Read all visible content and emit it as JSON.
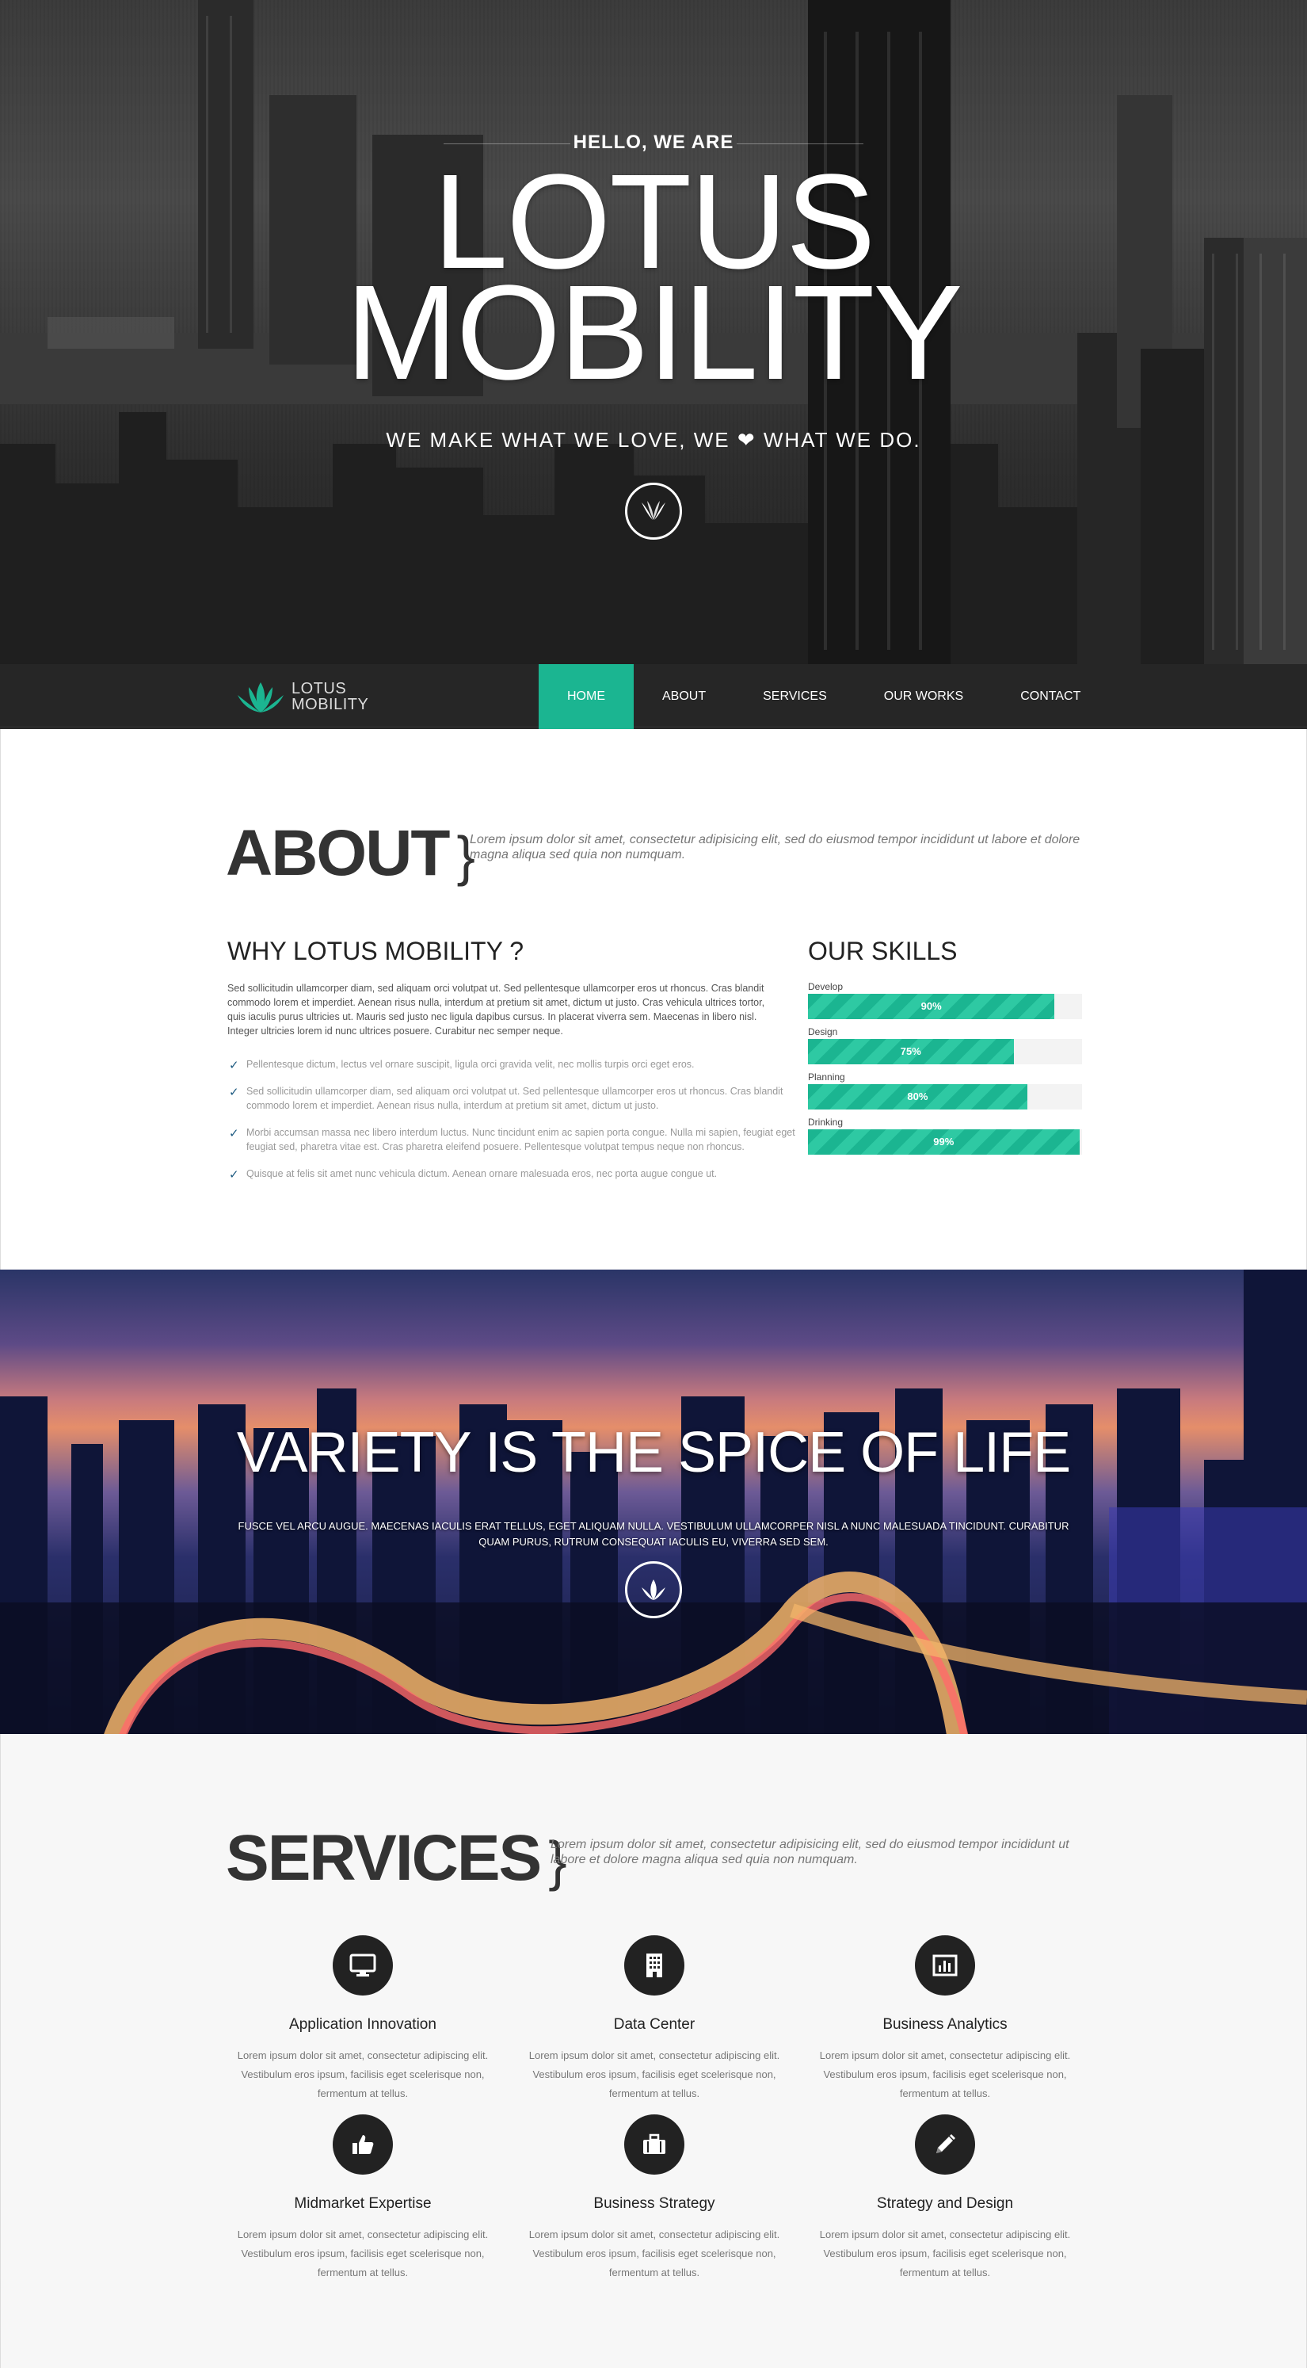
{
  "hero": {
    "greeting": "HELLO, WE ARE",
    "title_line1": "LOTUS",
    "title_line2": "MOBILITY",
    "tagline_before": "WE MAKE WHAT WE LOVE, WE",
    "tagline_after": "WHAT WE DO.",
    "heart_glyph": "❤",
    "scroll_icon": "lotus-icon"
  },
  "nav": {
    "logo_line1": "LOTUS",
    "logo_line2": "MOBILITY",
    "items": [
      {
        "label": "HOME",
        "active": true
      },
      {
        "label": "ABOUT",
        "active": false
      },
      {
        "label": "SERVICES",
        "active": false
      },
      {
        "label": "OUR WORKS",
        "active": false
      },
      {
        "label": "CONTACT",
        "active": false
      }
    ]
  },
  "about": {
    "heading": "ABOUT",
    "brace": "}",
    "intro": "Lorem ipsum dolor sit amet, consectetur adipisicing elit, sed do eiusmod tempor incididunt ut labore et dolore magna aliqua sed quia non numquam.",
    "why_title": "WHY LOTUS MOBILITY ?",
    "why_paragraph": "Sed sollicitudin ullamcorper diam, sed aliquam orci volutpat ut. Sed pellentesque ullamcorper eros ut rhoncus. Cras blandit commodo lorem et imperdiet. Aenean risus nulla, interdum at pretium sit amet, dictum ut justo. Cras vehicula ultrices tortor, quis iaculis purus ultricies ut. Mauris sed justo nec ligula dapibus cursus. In placerat viverra sem. Maecenas in libero nisl. Integer ultricies lorem id nunc ultrices posuere. Curabitur nec semper neque.",
    "checklist": [
      "Pellentesque dictum, lectus vel ornare suscipit, ligula orci gravida velit, nec mollis turpis orci eget eros.",
      "Sed sollicitudin ullamcorper diam, sed aliquam orci volutpat ut. Sed pellentesque ullamcorper eros ut rhoncus. Cras blandit commodo lorem et imperdiet. Aenean risus nulla, interdum at pretium sit amet, dictum ut justo.",
      "Morbi accumsan massa nec libero interdum luctus. Nunc tincidunt enim ac sapien porta congue. Nulla mi sapien, feugiat eget feugiat sed, pharetra vitae est. Cras pharetra eleifend posuere. Pellentesque volutpat tempus neque non rhoncus.",
      "Quisque at felis sit amet nunc vehicula dictum. Aenean ornare malesuada eros, nec porta augue congue ut."
    ],
    "skills_title": "OUR SKILLS",
    "skills": [
      {
        "label": "Develop",
        "percent_text": "90%",
        "value": 90
      },
      {
        "label": "Design",
        "percent_text": "75%",
        "value": 75
      },
      {
        "label": "Planning",
        "percent_text": "80%",
        "value": 80
      },
      {
        "label": "Drinking",
        "percent_text": "99%",
        "value": 99
      }
    ],
    "accent_color": "#1bb591"
  },
  "variety": {
    "title": "VARIETY IS THE SPICE OF LIFE",
    "text": "FUSCE VEL ARCU AUGUE. MAECENAS IACULIS ERAT TELLUS, EGET ALIQUAM NULLA. VESTIBULUM ULLAMCORPER NISL A NUNC MALESUADA TINCIDUNT. CURABITUR QUAM PURUS, RUTRUM CONSEQUAT IACULIS EU, VIVERRA SED SEM.",
    "scroll_icon": "lotus-icon"
  },
  "services": {
    "heading": "SERVICES",
    "brace": "}",
    "intro": "Lorem ipsum dolor sit amet, consectetur adipisicing elit, sed do eiusmod tempor incididunt ut labore et dolore magna aliqua sed quia non numquam.",
    "items": [
      {
        "icon": "monitor-icon",
        "title": "Application Innovation",
        "text": "Lorem ipsum dolor sit amet, consectetur adipiscing elit. Vestibulum eros ipsum, facilisis eget scelerisque non, fermentum at tellus."
      },
      {
        "icon": "building-icon",
        "title": "Data Center",
        "text": "Lorem ipsum dolor sit amet, consectetur adipiscing elit. Vestibulum eros ipsum, facilisis eget scelerisque non, fermentum at tellus."
      },
      {
        "icon": "bar-chart-icon",
        "title": "Business Analytics",
        "text": "Lorem ipsum dolor sit amet, consectetur adipiscing elit. Vestibulum eros ipsum, facilisis eget scelerisque non, fermentum at tellus."
      },
      {
        "icon": "thumbs-up-icon",
        "title": "Midmarket Expertise",
        "text": "Lorem ipsum dolor sit amet, consectetur adipiscing elit. Vestibulum eros ipsum, facilisis eget scelerisque non, fermentum at tellus."
      },
      {
        "icon": "briefcase-icon",
        "title": "Business Strategy",
        "text": "Lorem ipsum dolor sit amet, consectetur adipiscing elit. Vestibulum eros ipsum, facilisis eget scelerisque non, fermentum at tellus."
      },
      {
        "icon": "pencil-icon",
        "title": "Strategy and Design",
        "text": "Lorem ipsum dolor sit amet, consectetur adipiscing elit. Vestibulum eros ipsum, facilisis eget scelerisque non, fermentum at tellus."
      }
    ]
  }
}
